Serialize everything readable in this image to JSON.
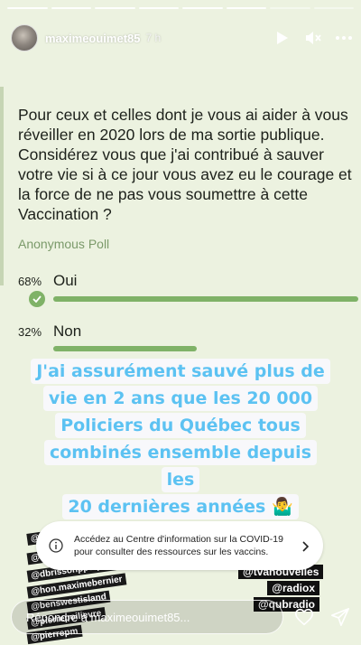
{
  "header": {
    "username": "maximeouimet85",
    "time": "7 h",
    "play_icon": "play-icon",
    "mute_icon": "mute-icon",
    "more_icon": "more-icon"
  },
  "poll": {
    "question": "Pour ceux et celles dont je vous ai aider à vous réveiller en 2020 lors de ma sortie publique. Considérez vous que j'ai contribué à sauver votre vie si à ce jour vous avez eu le courage et la force de ne pas vous soumettre à cette Vaccination ?",
    "type_label": "Anonymous Poll",
    "options": [
      {
        "percent": "68%",
        "label": "Oui",
        "fraction": 0.68,
        "selected": true
      },
      {
        "percent": "32%",
        "label": "Non",
        "fraction": 0.32,
        "selected": false
      }
    ]
  },
  "overlay_text": {
    "lines": [
      "J'ai assurément sauvé plus de",
      "vie en 2 ans que les 20 000",
      "Policiers du Québec tous",
      "combinés ensemble depuis les",
      "20 dernières années 🤷‍♂️"
    ]
  },
  "tags_left": [
    "@barre",
    "@americansheriff",
    "@dbrissonppcquebec",
    "@hon.maximebernier",
    "@benswestisland",
    "@pierrepoilievre",
    "@pierrepm"
  ],
  "tags_right": [
    "@tvanouvelles",
    "@radiox",
    "@qubradio"
  ],
  "covid_banner": {
    "text": "Accédez au Centre d'information sur la COVID-19 pour consulter des ressources sur les vaccins."
  },
  "reply": {
    "placeholder": "Répondre à maximeouimet85..."
  },
  "colors": {
    "background": "#ecf2e0",
    "poll_green": "#7fb267",
    "overlay_blue": "#5cc2f2"
  }
}
